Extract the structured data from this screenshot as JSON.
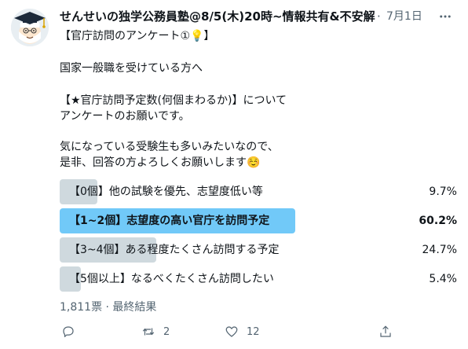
{
  "tweet": {
    "author_name": "せんせいの独学公務員塾@8/5(木)20時~情報共有&不安解消:",
    "date_separator": "·",
    "date": "7月1日",
    "more_icon": "more-horizontal-icon",
    "lines": [
      "【官庁訪問のアンケート①💡】",
      "国家一般職を受けている方へ",
      "【★官庁訪問予定数(何個まわるか)】について",
      "アンケートのお願いです。",
      "気になっている受験生も多いみたいなので、",
      "是非、回答の方よろしくお願いします☺️"
    ]
  },
  "poll": {
    "options": [
      {
        "label": "【0個】他の試験を優先、志望度低い等",
        "percent_text": "9.7%",
        "value": 9.7
      },
      {
        "label": "【1~2個】志望度の高い官庁を訪問予定",
        "percent_text": "60.2%",
        "value": 60.2
      },
      {
        "label": "【3~4個】ある程度たくさん訪問する予定",
        "percent_text": "24.7%",
        "value": 24.7
      },
      {
        "label": "【5個以上】なるべくたくさん訪問したい",
        "percent_text": "5.4%",
        "value": 5.4
      }
    ],
    "winner_index": 1,
    "footer": "1,811票 · 最終結果",
    "colors": {
      "bar": "#cfd9de",
      "winner_bar": "#71c9f8"
    }
  },
  "actions": {
    "reply_icon": "reply-icon",
    "retweet_icon": "retweet-icon",
    "retweet_count": "2",
    "like_icon": "heart-icon",
    "like_count": "12",
    "share_icon": "share-icon"
  }
}
